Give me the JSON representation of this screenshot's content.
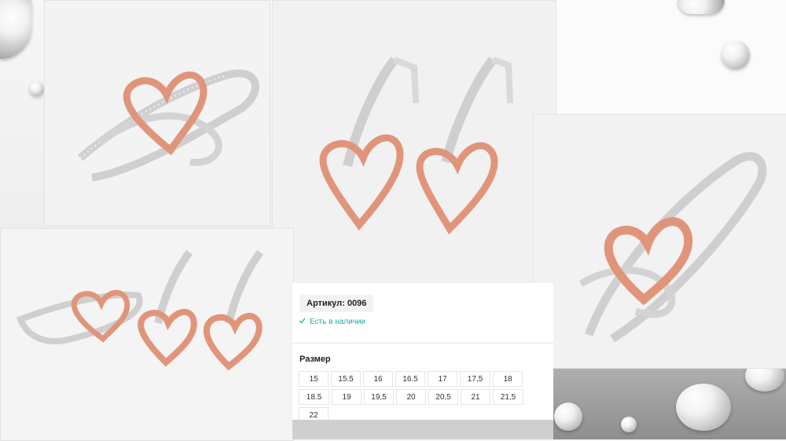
{
  "product": {
    "sku_label": "Артикул: 0096",
    "stock_text": "Есть в наличии",
    "size_title": "Размер",
    "sizes_row1": [
      "15",
      "15.5",
      "16",
      "16.5",
      "17",
      "17,5",
      "18",
      "18.5"
    ],
    "sizes_row2": [
      "19",
      "19,5",
      "20",
      "20,5",
      "21",
      "21,5",
      "22"
    ]
  },
  "colors": {
    "accent": "#22aaa0",
    "rose_gold": "#e0957a",
    "silver": "#cfcfcf"
  },
  "icons": {
    "stock": "check-icon"
  }
}
